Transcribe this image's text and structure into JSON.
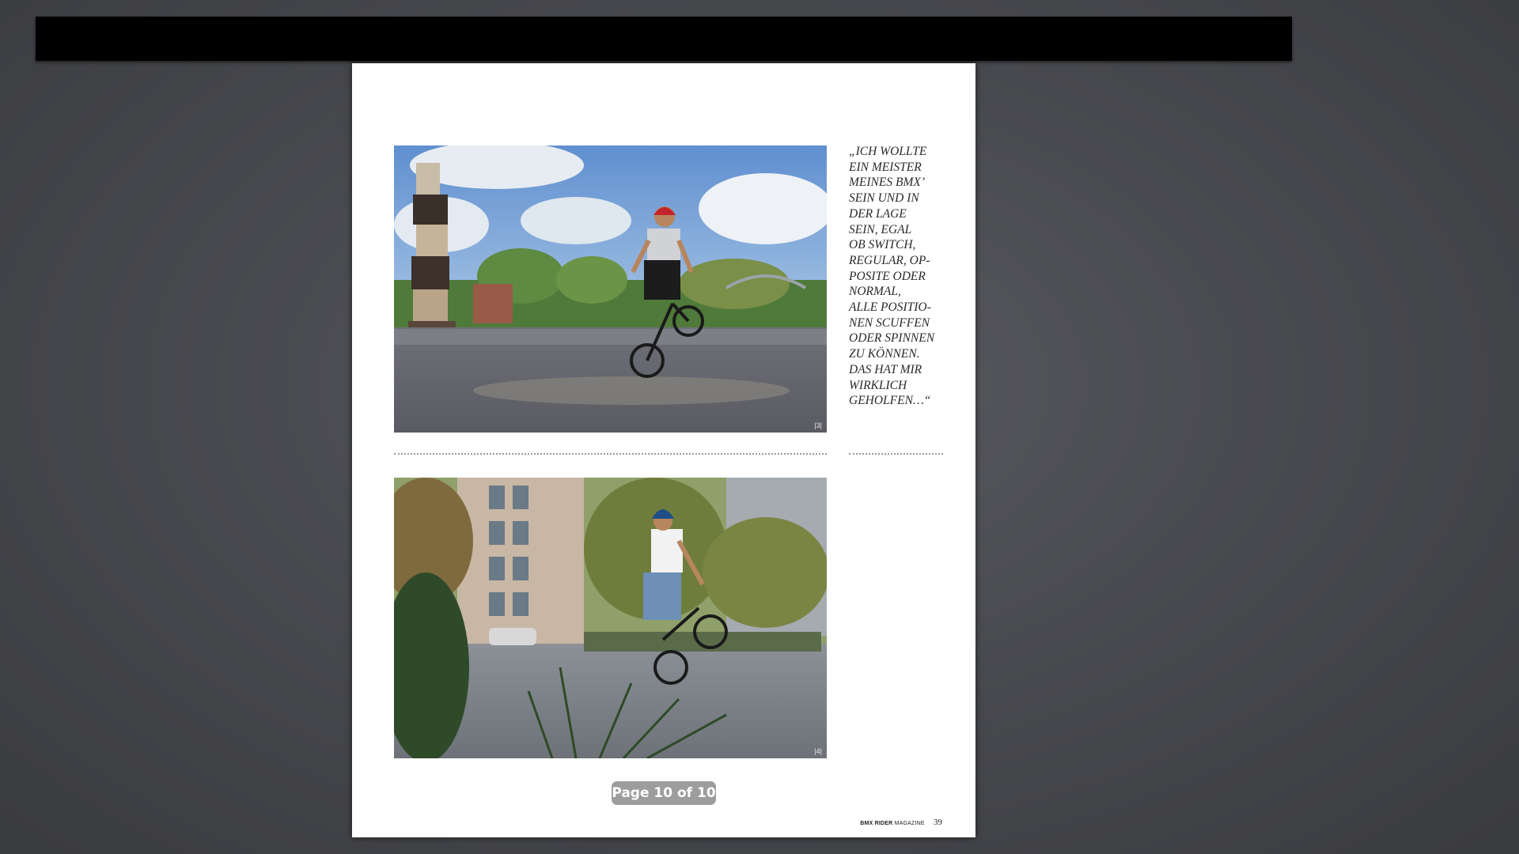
{
  "viewer": {
    "pager_label": "Page 10 of 10"
  },
  "magazine_page": {
    "photo_1_number": "|3|",
    "photo_2_number": "|4|",
    "quote_lines": [
      "„Ich wollte",
      "ein Meister",
      "meines BMX’",
      "sein und in",
      "der Lage",
      "sein, egal",
      "ob Switch,",
      "Regular, Op-",
      "posite oder",
      "normal,",
      "alle Positio-",
      "nen scuffen",
      "oder spinnen",
      "zu können.",
      "Das hat mir",
      "wirklich",
      "geholfen…“"
    ],
    "footer_brand": "BMX RIDER",
    "footer_magazine": "MAGAZINE",
    "footer_page_number": "39"
  }
}
